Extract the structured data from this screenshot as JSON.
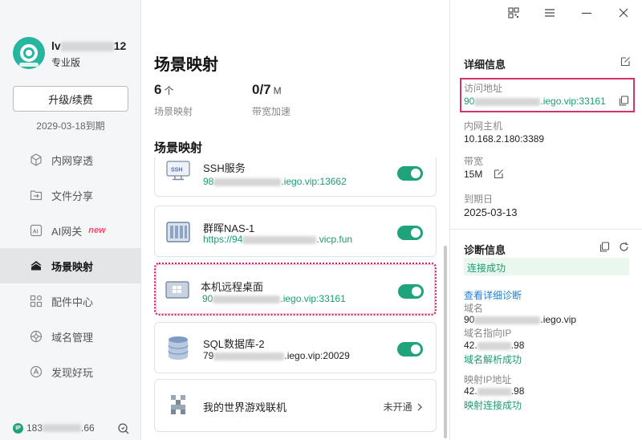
{
  "window": {
    "controls": [
      "qr-code-icon",
      "menu-icon",
      "minimize-icon",
      "close-icon"
    ]
  },
  "user": {
    "name_prefix": "lv",
    "name_suffix": "12",
    "edition": "专业版",
    "upgrade_label": "升级/续费",
    "expire_text": "2029-03-18到期"
  },
  "nav": {
    "items": [
      {
        "label": "内网穿透",
        "icon": "cube-icon",
        "active": false
      },
      {
        "label": "文件分享",
        "icon": "folder-share-icon",
        "active": false
      },
      {
        "label": "AI网关",
        "icon": "ai-icon",
        "active": false,
        "badge": "new"
      },
      {
        "label": "场景映射",
        "icon": "scene-icon",
        "active": true
      },
      {
        "label": "配件中心",
        "icon": "grid-icon",
        "active": false
      },
      {
        "label": "域名管理",
        "icon": "globe-icon",
        "active": false
      },
      {
        "label": "发现好玩",
        "icon": "discover-icon",
        "active": false
      }
    ]
  },
  "footer": {
    "ip_prefix": "183",
    "ip_suffix": ".66",
    "ip_icon_text": "IP"
  },
  "main": {
    "title": "场景映射",
    "stats": [
      {
        "value": "6",
        "unit": "个",
        "label": "场景映射"
      },
      {
        "value": "0/7",
        "unit": "M",
        "label": "带宽加速"
      }
    ],
    "section_title": "场景映射",
    "cards": [
      {
        "name": "SSH服务",
        "addr_prefix": "98",
        "addr_suffix": ".iego.vip:13662",
        "icon": "ssh-icon",
        "icon_text": "SSH",
        "enabled": true
      },
      {
        "name": "群晖NAS-1",
        "addr_prefix": "https://94",
        "addr_suffix": ".vicp.fun",
        "icon": "nas-icon",
        "enabled": true
      },
      {
        "name": "本机远程桌面",
        "addr_prefix": "90",
        "addr_suffix": ".iego.vip:33161",
        "icon": "remote-desktop-icon",
        "enabled": true,
        "selected": true
      },
      {
        "name": "SQL数据库-2",
        "addr_prefix": "79",
        "addr_suffix": ".iego.vip:20029",
        "icon": "database-icon",
        "enabled": true
      },
      {
        "name": "我的世界游戏联机",
        "icon": "minecraft-icon",
        "status": "未开通",
        "enabled": false
      }
    ]
  },
  "detail": {
    "title": "详细信息",
    "access_label": "访问地址",
    "access_prefix": "90",
    "access_suffix": ".iego.vip:33161",
    "host_label": "内网主机",
    "host_value": "10.168.2.180:3389",
    "bandwidth_label": "带宽",
    "bandwidth_value": "15M",
    "expire_label": "到期日",
    "expire_value": "2025-03-13"
  },
  "diagnosis": {
    "title": "诊断信息",
    "status": "连接成功",
    "detail_link": "查看详细诊断",
    "domain_label": "域名",
    "domain_prefix": "90",
    "domain_suffix": ".iego.vip",
    "domain_ip_label": "域名指向IP",
    "domain_ip_prefix": "42.",
    "domain_ip_suffix": ".98",
    "domain_ip_status": "域名解析成功",
    "mapped_ip_label": "映射IP地址",
    "mapped_ip_prefix": "42.",
    "mapped_ip_suffix": ".98",
    "mapped_ip_status": "映射连接成功"
  },
  "colors": {
    "accent": "#1fa37a",
    "link": "#1d7fd8",
    "highlight": "#d6336c"
  }
}
